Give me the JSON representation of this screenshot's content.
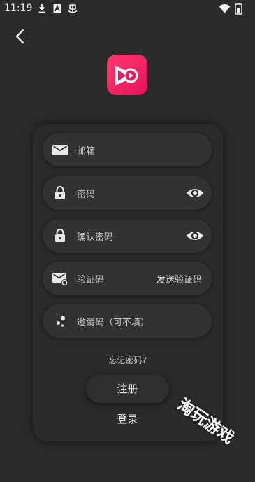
{
  "status_bar": {
    "time": "11:19",
    "notification_icons": [
      "download-icon",
      "app-a-icon",
      "app-bug-icon"
    ],
    "system_icons": [
      "wifi-icon",
      "battery-icon"
    ]
  },
  "header": {
    "back_icon": "chevron-left-icon",
    "logo_icon": "app-logo-play-icon",
    "brand_color": "#f0356a"
  },
  "form": {
    "email": {
      "placeholder": "邮箱",
      "icon": "mail-icon"
    },
    "password": {
      "placeholder": "密码",
      "icon": "lock-icon",
      "toggle_icon": "eye-icon"
    },
    "confirm_password": {
      "placeholder": "确认密码",
      "icon": "lock-icon",
      "toggle_icon": "eye-icon"
    },
    "verification_code": {
      "placeholder": "验证码",
      "icon": "mail-check-icon",
      "action_label": "发送验证码"
    },
    "invite_code": {
      "placeholder": "邀请码（可不填）",
      "icon": "dots-icon"
    }
  },
  "actions": {
    "forgot_password": "忘记密码?",
    "register": "注册",
    "login": "登录"
  },
  "watermark": "淘玩游戏"
}
